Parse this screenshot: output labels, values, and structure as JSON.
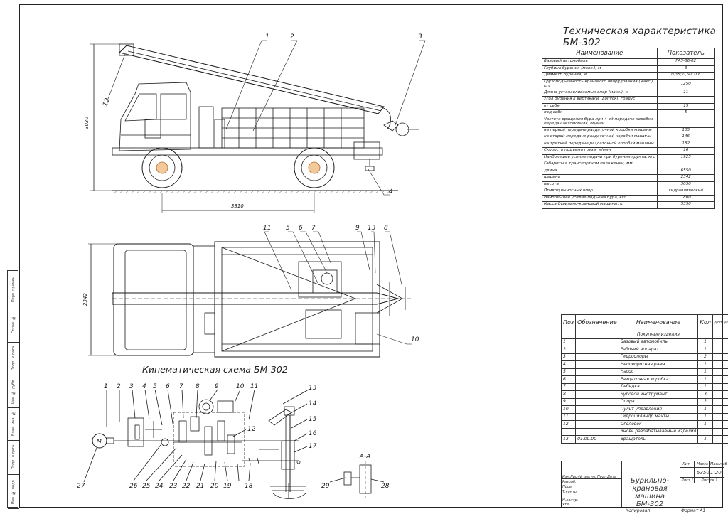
{
  "tech_title": "Техническая характеристика БМ-302",
  "tech_table": {
    "headers": [
      "Наименование",
      "Показатель"
    ],
    "rows": [
      [
        "Базовый автомобиль",
        "ГАЗ-66-02"
      ],
      [
        "Глубина бурения (макс.), м",
        "3"
      ],
      [
        "Диаметр бурения, м",
        "0,35; 0,50; 0,8"
      ],
      [
        "Грузоподъемность кранового оборудования (макс.), кгс",
        "1250"
      ],
      [
        "Длина устанавливаемых опор (макс.), м",
        "11"
      ],
      [
        "Угол бурения к вертикали (допуск), градус",
        ""
      ],
      [
        "от себя",
        "15"
      ],
      [
        "под себя",
        "5"
      ],
      [
        "Частота вращения бура при 4-ой передаче коробки передач автомобиля, об/мин",
        ""
      ],
      [
        "на первой передаче раздаточной коробки машины",
        "105"
      ],
      [
        "на второй передаче раздаточной коробки машины",
        "146"
      ],
      [
        "на третьей передаче раздаточной коробки машины",
        "182"
      ],
      [
        "Скорость подъема груза, м/мин",
        "16"
      ],
      [
        "Наибольшее усилие подачи при бурении грунта, кгс",
        "1925"
      ],
      [
        "Габариты в транспортном положении, мм",
        ""
      ],
      [
        "длина",
        "6550"
      ],
      [
        "ширина",
        "2342"
      ],
      [
        "высота",
        "3030"
      ],
      [
        "Привод выносных опор",
        "гидравлический"
      ],
      [
        "Наибольшее усилие подъема бура, кгс",
        "1800"
      ],
      [
        "Масса бурильно-крановой машины, кг",
        "5350"
      ]
    ]
  },
  "spec_table": {
    "headers": [
      "Поз",
      "Обозначение",
      "Наименование",
      "Кол",
      "Доп. указан."
    ],
    "rows": [
      [
        "",
        "",
        "Покупные изделия",
        "",
        ""
      ],
      [
        "1",
        "",
        "Базовый автомобиль",
        "1",
        ""
      ],
      [
        "2",
        "",
        "Рабочий аппарат",
        "1",
        ""
      ],
      [
        "3",
        "",
        "Гидроопоры",
        "2",
        ""
      ],
      [
        "4",
        "",
        "Неповоротная рама",
        "1",
        ""
      ],
      [
        "5",
        "",
        "Насос",
        "1",
        ""
      ],
      [
        "6",
        "",
        "Раздаточная коробка",
        "1",
        ""
      ],
      [
        "7",
        "",
        "Лебедка",
        "1",
        ""
      ],
      [
        "8",
        "",
        "Буровой инструмент",
        "3",
        ""
      ],
      [
        "9",
        "",
        "Опора",
        "2",
        ""
      ],
      [
        "10",
        "",
        "Пульт управления",
        "1",
        ""
      ],
      [
        "11",
        "",
        "Гидроцилиндр мачты",
        "1",
        ""
      ],
      [
        "12",
        "",
        "Оголовок",
        "1",
        ""
      ],
      [
        "",
        "",
        "Вновь разрабатываемые изделия",
        "",
        ""
      ],
      [
        "13",
        "01.00.00",
        "Вращатель",
        "1",
        ""
      ]
    ]
  },
  "kinematic_title": "Кинематическая схема БМ-302",
  "dimensions": {
    "height": "3030",
    "wheelbase": "3310",
    "width": "2342"
  },
  "section_label": "А–А",
  "side_callouts": [
    "1",
    "2",
    "3",
    "4",
    "12"
  ],
  "top_callouts": [
    "11",
    "5",
    "6",
    "7",
    "9",
    "13",
    "8",
    "10"
  ],
  "kin_callouts_top": [
    "1",
    "2",
    "3",
    "4",
    "5",
    "6",
    "7",
    "8",
    "9",
    "10",
    "11",
    "12",
    "13",
    "14",
    "15",
    "16",
    "17"
  ],
  "kin_callouts_bottom": [
    "27",
    "26",
    "25",
    "24",
    "23",
    "22",
    "21",
    "20",
    "19",
    "18",
    "29",
    "28"
  ],
  "motor_label": "М",
  "stamp": {
    "title": "Бурильно-крановая машина БМ-302",
    "headers": [
      "Лит.",
      "Масса",
      "Масштаб"
    ],
    "mass": "5350",
    "scale": "1:20",
    "sheet": "Лист 1",
    "sheets": "Листов 1",
    "rows": [
      "Изм.",
      "Лист",
      "№ докум.",
      "Подп.",
      "Дата",
      "Разраб.",
      "Пров.",
      "Т.контр.",
      "Н.контр.",
      "Утв."
    ]
  },
  "side_strip": [
    "Перв. примен.",
    "Справ. №",
    "Подп. и дата",
    "Инв. № дубл.",
    "Взам. инв. №",
    "Подп. и дата",
    "Инв. № подл."
  ],
  "footer": {
    "copied": "Копировал",
    "format": "Формат А1"
  },
  "colors": {
    "line": "#1a1a1a",
    "hatch": "#444444"
  }
}
